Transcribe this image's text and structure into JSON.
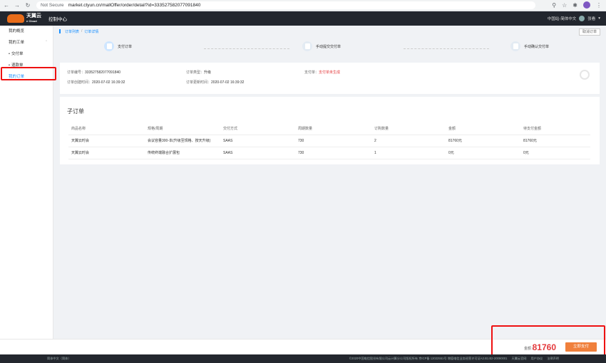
{
  "browser": {
    "security": "Not Secure",
    "url": "market.ctyun.cn/mallOffer/order/detail?id=333527582077091840"
  },
  "header": {
    "logo_text": "天翼云",
    "logo_sub": "e Cloud",
    "console": "控制中心",
    "region": "中国站-简体中文",
    "user": "张看"
  },
  "sidebar": {
    "items": [
      {
        "label": "我的概览"
      },
      {
        "label": "我的工单"
      },
      {
        "label": "交付单"
      },
      {
        "label": "退款单"
      },
      {
        "label": "我的订单"
      }
    ]
  },
  "breadcrumb": {
    "list": "订单列表",
    "sep": "/",
    "detail": "订单详情"
  },
  "cancel_label": "取消订单",
  "steps": [
    {
      "label": "支付订单"
    },
    {
      "label": "手动提交交付单"
    },
    {
      "label": "手动确认交付单"
    }
  ],
  "order_info": {
    "order_no_label": "订单编号：",
    "order_no": "333527582077091840",
    "type_label": "订单类型：",
    "type": "升级",
    "pay_label": "支付单：",
    "pay_status": "支付单未生成",
    "created_label": "订单创建时间：",
    "created": "2020-07-02 16:39:32",
    "updated_label": "订单更新时间：",
    "updated": "2020-07-02 16:39:32"
  },
  "sub_orders": {
    "title": "子订单",
    "headers": [
      "商品名称",
      "规格/周期",
      "交付方式",
      "周期数量",
      "订购数量",
      "金额",
      "待支付金额"
    ],
    "rows": [
      [
        "天翼云时会",
        "会议容量300-本(升级至规格、按天升级)",
        "SAAS",
        "730",
        "2",
        "81760元",
        "81760元"
      ],
      [
        "天翼云时会",
        "传统终端融合扩展包",
        "SAAS",
        "730",
        "1",
        "0元",
        "0元"
      ]
    ]
  },
  "bottom": {
    "total_label": "金额：",
    "total": "81760",
    "pay_button": "立即支付"
  },
  "footer": {
    "lang": "简体中文（简体）",
    "copyright": "©2020中国电信股份有限公司云计算分公司版权所有 京ICP备 12022551号 增值电信业务经营许可证A2.B1.B2-20090001",
    "links": [
      "天翼云官网",
      "用户协议",
      "法律声明"
    ]
  }
}
